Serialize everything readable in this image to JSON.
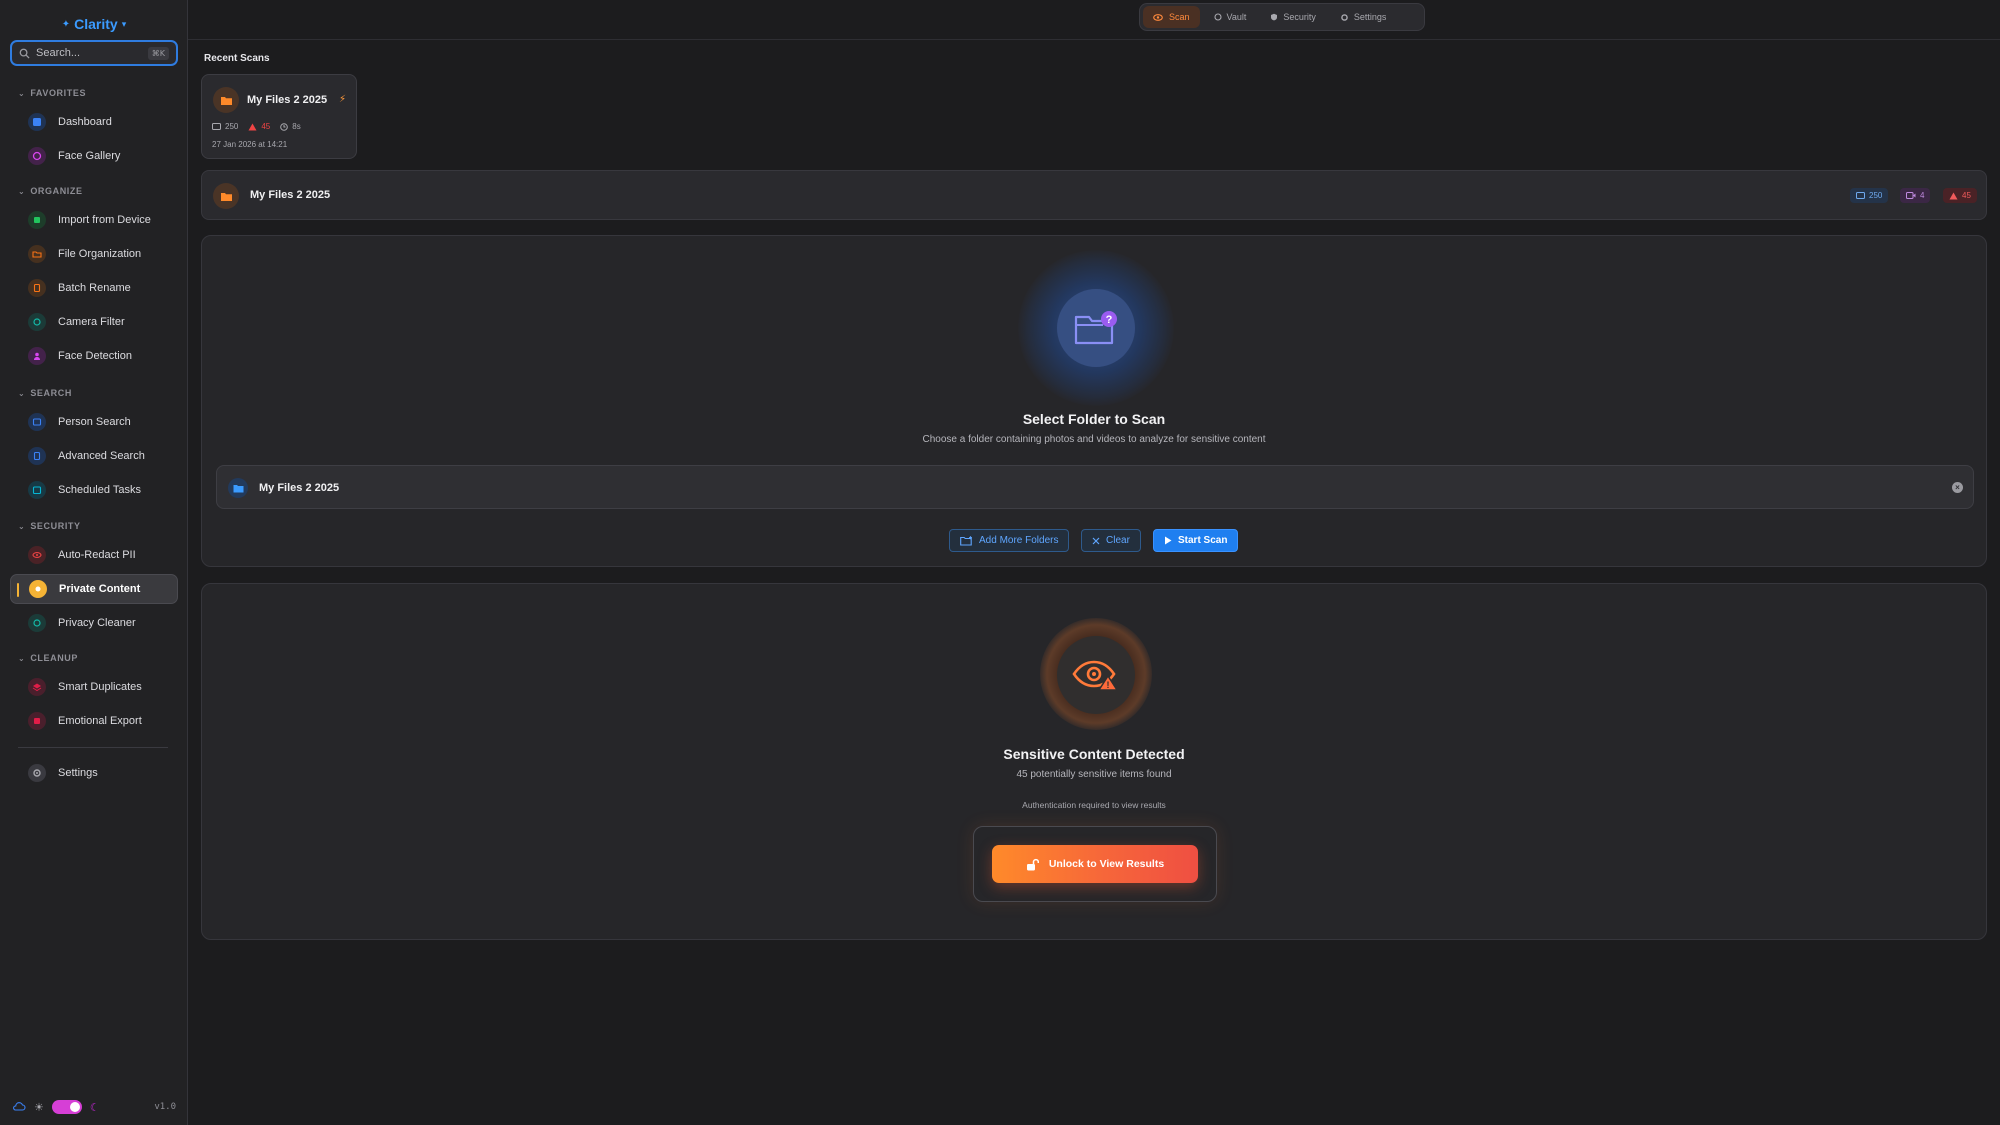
{
  "app": {
    "name": "Clarity",
    "version": "v1.0"
  },
  "search": {
    "placeholder": "Search...",
    "shortcut": "⌘K"
  },
  "sidebar": {
    "sections": [
      {
        "title": "FAVORITES",
        "items": [
          {
            "label": "Dashboard",
            "icon": "dashboard-icon",
            "color": "#3b82f6"
          },
          {
            "label": "Face Gallery",
            "icon": "face-gallery-icon",
            "color": "#c026d3"
          }
        ]
      },
      {
        "title": "ORGANIZE",
        "items": [
          {
            "label": "Import from Device",
            "icon": "import-icon",
            "color": "#22c55e"
          },
          {
            "label": "File Organization",
            "icon": "folder-icon",
            "color": "#f97316"
          },
          {
            "label": "Batch Rename",
            "icon": "rename-icon",
            "color": "#f97316"
          },
          {
            "label": "Camera Filter",
            "icon": "camera-icon",
            "color": "#14b8a6"
          },
          {
            "label": "Face Detection",
            "icon": "face-detection-icon",
            "color": "#c026d3"
          }
        ]
      },
      {
        "title": "SEARCH",
        "items": [
          {
            "label": "Person Search",
            "icon": "person-search-icon",
            "color": "#3b82f6"
          },
          {
            "label": "Advanced Search",
            "icon": "advanced-search-icon",
            "color": "#3b82f6"
          },
          {
            "label": "Scheduled Tasks",
            "icon": "calendar-icon",
            "color": "#06b6d4"
          }
        ]
      },
      {
        "title": "SECURITY",
        "items": [
          {
            "label": "Auto-Redact PII",
            "icon": "eye-icon",
            "color": "#ef4444"
          },
          {
            "label": "Private Content",
            "icon": "shield-icon",
            "color": "#f5b335",
            "active": true
          },
          {
            "label": "Privacy Cleaner",
            "icon": "cleaner-icon",
            "color": "#14b8a6"
          }
        ]
      },
      {
        "title": "CLEANUP",
        "items": [
          {
            "label": "Smart Duplicates",
            "icon": "duplicates-icon",
            "color": "#e11d48"
          },
          {
            "label": "Emotional Export",
            "icon": "export-icon",
            "color": "#e11d48"
          }
        ]
      }
    ],
    "settings_label": "Settings"
  },
  "tabs": [
    {
      "label": "Scan",
      "icon": "scan-eye-icon",
      "active": true
    },
    {
      "label": "Vault",
      "icon": "vault-icon"
    },
    {
      "label": "Security",
      "icon": "security-icon"
    },
    {
      "label": "Settings",
      "icon": "gear-icon"
    }
  ],
  "recent": {
    "title": "Recent Scans",
    "card": {
      "name": "My Files 2 2025",
      "images": "250",
      "alerts": "45",
      "duration": "8s",
      "date": "27 Jan 2026 at 14:21"
    }
  },
  "folder_row": {
    "name": "My Files 2 2025",
    "images": "250",
    "videos": "4",
    "alerts": "45"
  },
  "scan_panel": {
    "title": "Select Folder to Scan",
    "subtitle": "Choose a folder containing photos and videos to analyze for sensitive content",
    "selected_folder": "My Files 2 2025",
    "add_more_label": "Add More Folders",
    "clear_label": "Clear",
    "start_label": "Start Scan"
  },
  "sensitive": {
    "title": "Sensitive Content Detected",
    "subtitle": "45 potentially sensitive items found",
    "auth_note": "Authentication required to view results",
    "unlock_label": "Unlock to View Results"
  },
  "colors": {
    "accent_blue": "#1f7ff0",
    "accent_orange": "#ff8a2a",
    "alert_red": "#ef4444",
    "active_marker": "#f5b335"
  }
}
